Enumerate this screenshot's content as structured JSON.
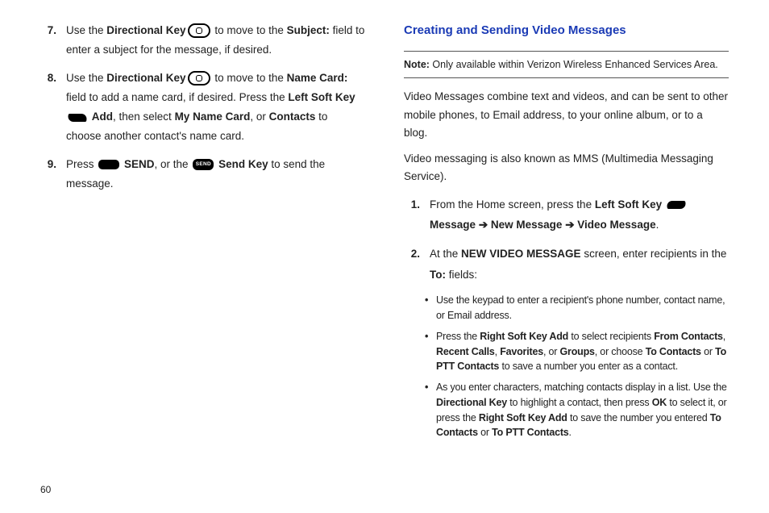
{
  "left": {
    "items": [
      {
        "num": "7.",
        "parts": [
          {
            "t": "Use the "
          },
          {
            "t": "Directional Key",
            "b": true
          },
          {
            "icon": "directional-key-icon"
          },
          {
            "t": " to move to the "
          },
          {
            "t": "Subject:",
            "b": true
          },
          {
            "t": " field to enter a subject for the message, if desired."
          }
        ]
      },
      {
        "num": "8.",
        "parts": [
          {
            "t": "Use the "
          },
          {
            "t": "Directional Key",
            "b": true
          },
          {
            "icon": "directional-key-icon"
          },
          {
            "t": " to move to the "
          },
          {
            "t": "Name Card:",
            "b": true
          },
          {
            "t": " field to add a name card, if desired. Press the "
          },
          {
            "t": "Left Soft Key",
            "b": true
          },
          {
            "t": " "
          },
          {
            "icon": "left-soft-key-icon"
          },
          {
            "t": " "
          },
          {
            "t": "Add",
            "b": true
          },
          {
            "t": ", then select "
          },
          {
            "t": "My Name Card",
            "b": true
          },
          {
            "t": ", or "
          },
          {
            "t": "Contacts",
            "b": true
          },
          {
            "t": " to choose another contact's name card."
          }
        ]
      },
      {
        "num": "9.",
        "parts": [
          {
            "t": "Press "
          },
          {
            "icon": "center-key-icon"
          },
          {
            "t": " "
          },
          {
            "t": "SEND",
            "b": true
          },
          {
            "t": ", or the "
          },
          {
            "icon": "send-key-icon"
          },
          {
            "t": " "
          },
          {
            "t": "Send Key",
            "b": true
          },
          {
            "t": " to send the message."
          }
        ]
      }
    ]
  },
  "right": {
    "heading": "Creating and Sending Video Messages",
    "note_label": "Note:",
    "note_text": " Only available within Verizon Wireless Enhanced Services Area.",
    "para1": "Video Messages combine text and videos, and can be sent to other mobile phones, to Email address, to your online album, or to a blog.",
    "para2": "Video messaging is also known as MMS (Multimedia Messaging Service).",
    "items": [
      {
        "num": "1.",
        "parts": [
          {
            "t": "From the Home screen, press the "
          },
          {
            "t": "Left Soft Key",
            "b": true
          },
          {
            "t": " "
          },
          {
            "icon": "left-soft-key-icon-r"
          },
          {
            "t": " "
          },
          {
            "t": "Message",
            "b": true
          },
          {
            "t": "  "
          },
          {
            "t": "➔",
            "arrow": true
          },
          {
            "t": " "
          },
          {
            "t": "New Message",
            "b": true
          },
          {
            "t": " "
          },
          {
            "t": "➔",
            "arrow": true
          },
          {
            "t": " "
          },
          {
            "t": "Video Message",
            "b": true
          },
          {
            "t": "."
          }
        ]
      },
      {
        "num": "2.",
        "parts": [
          {
            "t": "At the "
          },
          {
            "t": "NEW VIDEO MESSAGE",
            "b": true
          },
          {
            "t": " screen, enter recipients in the "
          },
          {
            "t": "To:",
            "b": true
          },
          {
            "t": " fields:"
          }
        ]
      }
    ],
    "bullets": [
      {
        "parts": [
          {
            "t": "Use the keypad to enter a recipient's phone number, contact name, or Email address."
          }
        ]
      },
      {
        "parts": [
          {
            "t": "Press the "
          },
          {
            "t": "Right Soft Key Add",
            "b": true
          },
          {
            "t": " to select recipients "
          },
          {
            "t": "From Contacts",
            "b": true
          },
          {
            "t": ", "
          },
          {
            "t": "Recent Calls",
            "b": true
          },
          {
            "t": ", "
          },
          {
            "t": "Favorites",
            "b": true
          },
          {
            "t": ", or "
          },
          {
            "t": "Groups",
            "b": true
          },
          {
            "t": ", or choose "
          },
          {
            "t": "To Contacts",
            "b": true
          },
          {
            "t": " or "
          },
          {
            "t": "To PTT Contacts",
            "b": true
          },
          {
            "t": " to save a number you enter as a contact."
          }
        ]
      },
      {
        "parts": [
          {
            "t": "As you enter characters, matching contacts display in a list. Use the "
          },
          {
            "t": "Directional Key",
            "b": true
          },
          {
            "t": " to highlight a contact, then press "
          },
          {
            "t": "OK",
            "b": true
          },
          {
            "t": " to select it, or press the "
          },
          {
            "t": "Right Soft Key Add",
            "b": true
          },
          {
            "t": " to save the number you entered "
          },
          {
            "t": "To Contacts",
            "b": true
          },
          {
            "t": " or "
          },
          {
            "t": "To PTT Contacts",
            "b": true
          },
          {
            "t": "."
          }
        ]
      }
    ]
  },
  "page_number": "60",
  "send_icon_label": "SEND"
}
